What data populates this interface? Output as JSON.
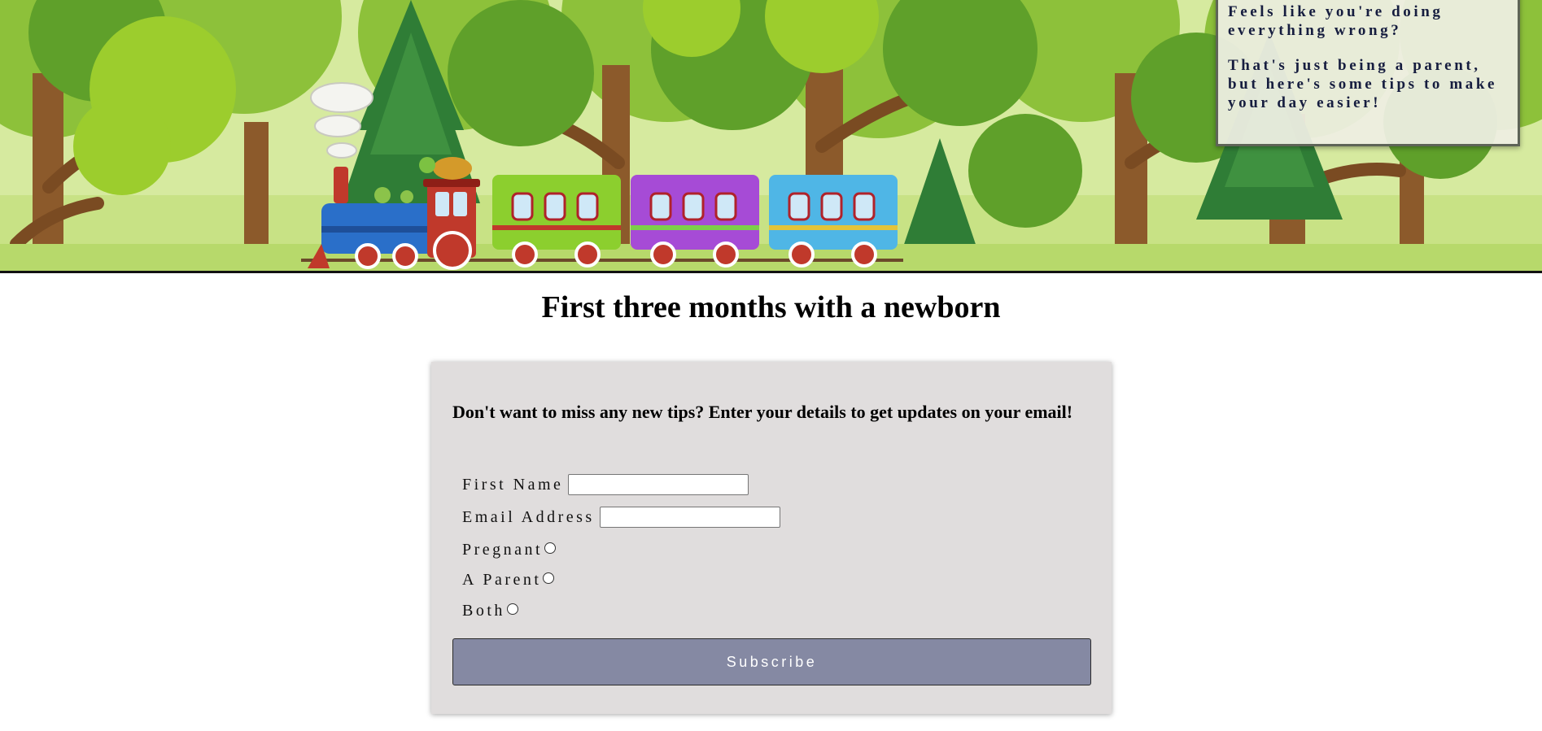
{
  "banner": {
    "intro_line1": "Feels like you're doing everything wrong?",
    "intro_line2": "That's just being a parent, but here's some tips to make your day easier!"
  },
  "page": {
    "title": "First three months with a newborn"
  },
  "form": {
    "heading": "Don't want to miss any new tips? Enter your details to get updates on your email!",
    "first_name_label": "First Name",
    "first_name_value": "",
    "email_label": "Email Address",
    "email_value": "",
    "options": [
      "Pregnant",
      "A Parent",
      "Both"
    ],
    "subscribe_label": "Subscribe"
  },
  "colors": {
    "card_background": "#e0dddd",
    "subscribe_button": "#8589a3",
    "intro_text": "#161d3f"
  }
}
